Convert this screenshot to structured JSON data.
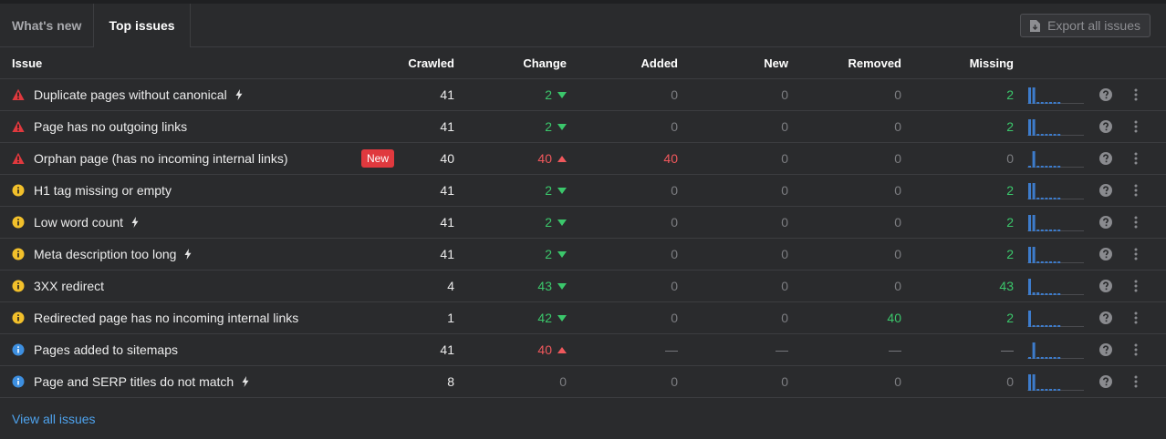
{
  "tabs": [
    {
      "label": "What's new",
      "active": false
    },
    {
      "label": "Top issues",
      "active": true
    }
  ],
  "export_label": "Export all issues",
  "columns": {
    "issue": "Issue",
    "crawled": "Crawled",
    "change": "Change",
    "added": "Added",
    "new": "New",
    "removed": "Removed",
    "missing": "Missing"
  },
  "colors": {
    "error": "#e0393e",
    "warning": "#f2c02b",
    "notice": "#3d8fe0",
    "green": "#3bc76b",
    "red": "#f0585c",
    "spark": "#3d7ccc"
  },
  "rows": [
    {
      "severity": "error",
      "icon": "error-triangle-icon",
      "name": "Duplicate pages without canonical",
      "bolt": true,
      "badge": "",
      "crawled": "41",
      "change": "2",
      "change_dir": "down",
      "added": "0",
      "new": "0",
      "removed": "0",
      "missing": "2",
      "missing_color": "green",
      "spark": [
        0.9,
        0.9,
        0.1,
        0.1,
        0.1,
        0.1,
        0.1,
        0.1
      ]
    },
    {
      "severity": "error",
      "icon": "error-triangle-icon",
      "name": "Page has no outgoing links",
      "bolt": false,
      "badge": "",
      "crawled": "41",
      "change": "2",
      "change_dir": "down",
      "added": "0",
      "new": "0",
      "removed": "0",
      "missing": "2",
      "missing_color": "green",
      "spark": [
        0.9,
        0.9,
        0.1,
        0.1,
        0.1,
        0.1,
        0.1,
        0.1
      ]
    },
    {
      "severity": "error",
      "icon": "error-triangle-icon",
      "name": "Orphan page (has no incoming internal links)",
      "bolt": false,
      "badge": "New",
      "crawled": "40",
      "change": "40",
      "change_dir": "up",
      "added": "40",
      "new": "0",
      "removed": "0",
      "missing": "0",
      "missing_color": "grey",
      "spark": [
        0.1,
        0.9,
        0.1,
        0.1,
        0.1,
        0.1,
        0.1,
        0.1
      ]
    },
    {
      "severity": "warning",
      "icon": "warning-info-icon",
      "name": "H1 tag missing or empty",
      "bolt": false,
      "badge": "",
      "crawled": "41",
      "change": "2",
      "change_dir": "down",
      "added": "0",
      "new": "0",
      "removed": "0",
      "missing": "2",
      "missing_color": "green",
      "spark": [
        0.9,
        0.9,
        0.1,
        0.1,
        0.1,
        0.1,
        0.1,
        0.1
      ]
    },
    {
      "severity": "warning",
      "icon": "warning-info-icon",
      "name": "Low word count",
      "bolt": true,
      "badge": "",
      "crawled": "41",
      "change": "2",
      "change_dir": "down",
      "added": "0",
      "new": "0",
      "removed": "0",
      "missing": "2",
      "missing_color": "green",
      "spark": [
        0.9,
        0.9,
        0.1,
        0.1,
        0.1,
        0.1,
        0.1,
        0.1
      ]
    },
    {
      "severity": "warning",
      "icon": "warning-info-icon",
      "name": "Meta description too long",
      "bolt": true,
      "badge": "",
      "crawled": "41",
      "change": "2",
      "change_dir": "down",
      "added": "0",
      "new": "0",
      "removed": "0",
      "missing": "2",
      "missing_color": "green",
      "spark": [
        0.9,
        0.9,
        0.1,
        0.1,
        0.1,
        0.1,
        0.1,
        0.1
      ]
    },
    {
      "severity": "warning",
      "icon": "warning-info-icon",
      "name": "3XX redirect",
      "bolt": false,
      "badge": "",
      "crawled": "4",
      "change": "43",
      "change_dir": "down",
      "added": "0",
      "new": "0",
      "removed": "0",
      "missing": "43",
      "missing_color": "green",
      "spark": [
        0.9,
        0.15,
        0.15,
        0.1,
        0.1,
        0.1,
        0.1,
        0.1
      ]
    },
    {
      "severity": "warning",
      "icon": "warning-info-icon",
      "name": "Redirected page has no incoming internal links",
      "bolt": false,
      "badge": "",
      "crawled": "1",
      "change": "42",
      "change_dir": "down",
      "added": "0",
      "new": "0",
      "removed": "40",
      "removed_color": "green",
      "missing": "2",
      "missing_color": "green",
      "spark": [
        0.9,
        0.1,
        0.1,
        0.1,
        0.1,
        0.1,
        0.1,
        0.1
      ]
    },
    {
      "severity": "notice",
      "icon": "notice-info-icon",
      "name": "Pages added to sitemaps",
      "bolt": false,
      "badge": "",
      "crawled": "41",
      "change": "40",
      "change_dir": "up",
      "added": "—",
      "new": "—",
      "removed": "—",
      "missing": "—",
      "missing_color": "grey",
      "spark": [
        0.1,
        0.9,
        0.1,
        0.1,
        0.1,
        0.1,
        0.1,
        0.1
      ]
    },
    {
      "severity": "notice",
      "icon": "notice-info-icon",
      "name": "Page and SERP titles do not match",
      "bolt": true,
      "badge": "",
      "crawled": "8",
      "change": "0",
      "change_dir": "none",
      "added": "0",
      "new": "0",
      "removed": "0",
      "missing": "0",
      "missing_color": "grey",
      "spark": [
        0.9,
        0.9,
        0.1,
        0.1,
        0.1,
        0.1,
        0.1,
        0.1
      ]
    }
  ],
  "footer_link": "View all issues"
}
